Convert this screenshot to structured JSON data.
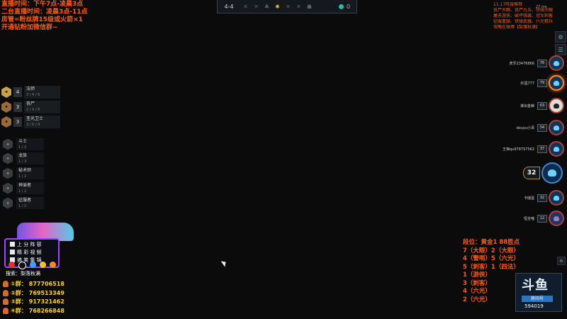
{
  "stream_info": [
    "直播时间：下午7点-凌晨3点",
    "二台直播时间：凌晨3点-11点",
    "房管=粉丝牌15级或火箭×1",
    "开通钻粉加微信群~"
  ],
  "stage_bar": {
    "stage": "4-4",
    "round_icons": [
      "sword-icon",
      "crossed-swords-icon",
      "monster-icon",
      "current-round-icon",
      "crossed-swords-icon",
      "crossed-swords-icon",
      "carousel-icon"
    ],
    "gold": "0"
  },
  "recommend": {
    "lines": [
      "11.17阵容推荐",
      "丧尸大眼、丧尸九五、铁骑大眼",
      "屠夫游侠、破坏强袭、冠军刺客",
      "征服重骸、铁骑武器、六光精兵",
      "攻略在微博【梨落秋满】"
    ],
    "fps": "27 ms"
  },
  "traits": [
    {
      "count": "4",
      "name": "法师",
      "breakpoints": "2 / 4 / 6",
      "tier": "gold"
    },
    {
      "count": "3",
      "name": "丧尸",
      "breakpoints": "2 / 4 / 6",
      "tier": "bronze"
    },
    {
      "count": "3",
      "name": "圣光卫士",
      "breakpoints": "3 / 6 / 9",
      "tier": "bronze"
    }
  ],
  "inactive_traits": [
    {
      "name": "斗士",
      "progress": "1 / 2"
    },
    {
      "name": "龙族",
      "progress": "1 / 3"
    },
    {
      "name": "秘术师",
      "progress": "1 / 2"
    },
    {
      "name": "神谕者",
      "progress": "1 / 2"
    },
    {
      "name": "征服者",
      "progress": "1 / 2"
    }
  ],
  "promo": {
    "lines": [
      "上 分 阵 容",
      "精 彩 视 频",
      "搞 笑 集 锦"
    ],
    "search": "搜索：梨落秋满"
  },
  "qq_groups": [
    {
      "label": "①群：",
      "number": "877706518"
    },
    {
      "label": "②群：",
      "number": "769513349"
    },
    {
      "label": "③群：",
      "number": "917321462"
    },
    {
      "label": "④群：",
      "number": "768266848"
    }
  ],
  "players": [
    {
      "name": "虎牙23476866",
      "hp": "76"
    },
    {
      "name": "红蛋777",
      "hp": "79"
    },
    {
      "name": "谋出金蝉",
      "hp": "63"
    },
    {
      "name": "douyu小泽",
      "hp": "54"
    },
    {
      "name": "王禅qu9787S7562",
      "hp": "37"
    },
    {
      "name": "",
      "hp": "32"
    },
    {
      "name": "卡储蛋",
      "hp": "32"
    },
    {
      "name": "恒全喵",
      "hp": "12"
    }
  ],
  "rank": [
    "段位：黄金1  88胜点",
    "7（大眼）2（大眼）",
    "4（警哨）5（六光）",
    "5（刺客）1（四法）",
    "1（游侠）",
    "3（刺客）",
    "4（六光）",
    "2（六光）"
  ],
  "logo": {
    "text": "斗鱼",
    "room_label": "房间号",
    "room_number": "594019"
  }
}
